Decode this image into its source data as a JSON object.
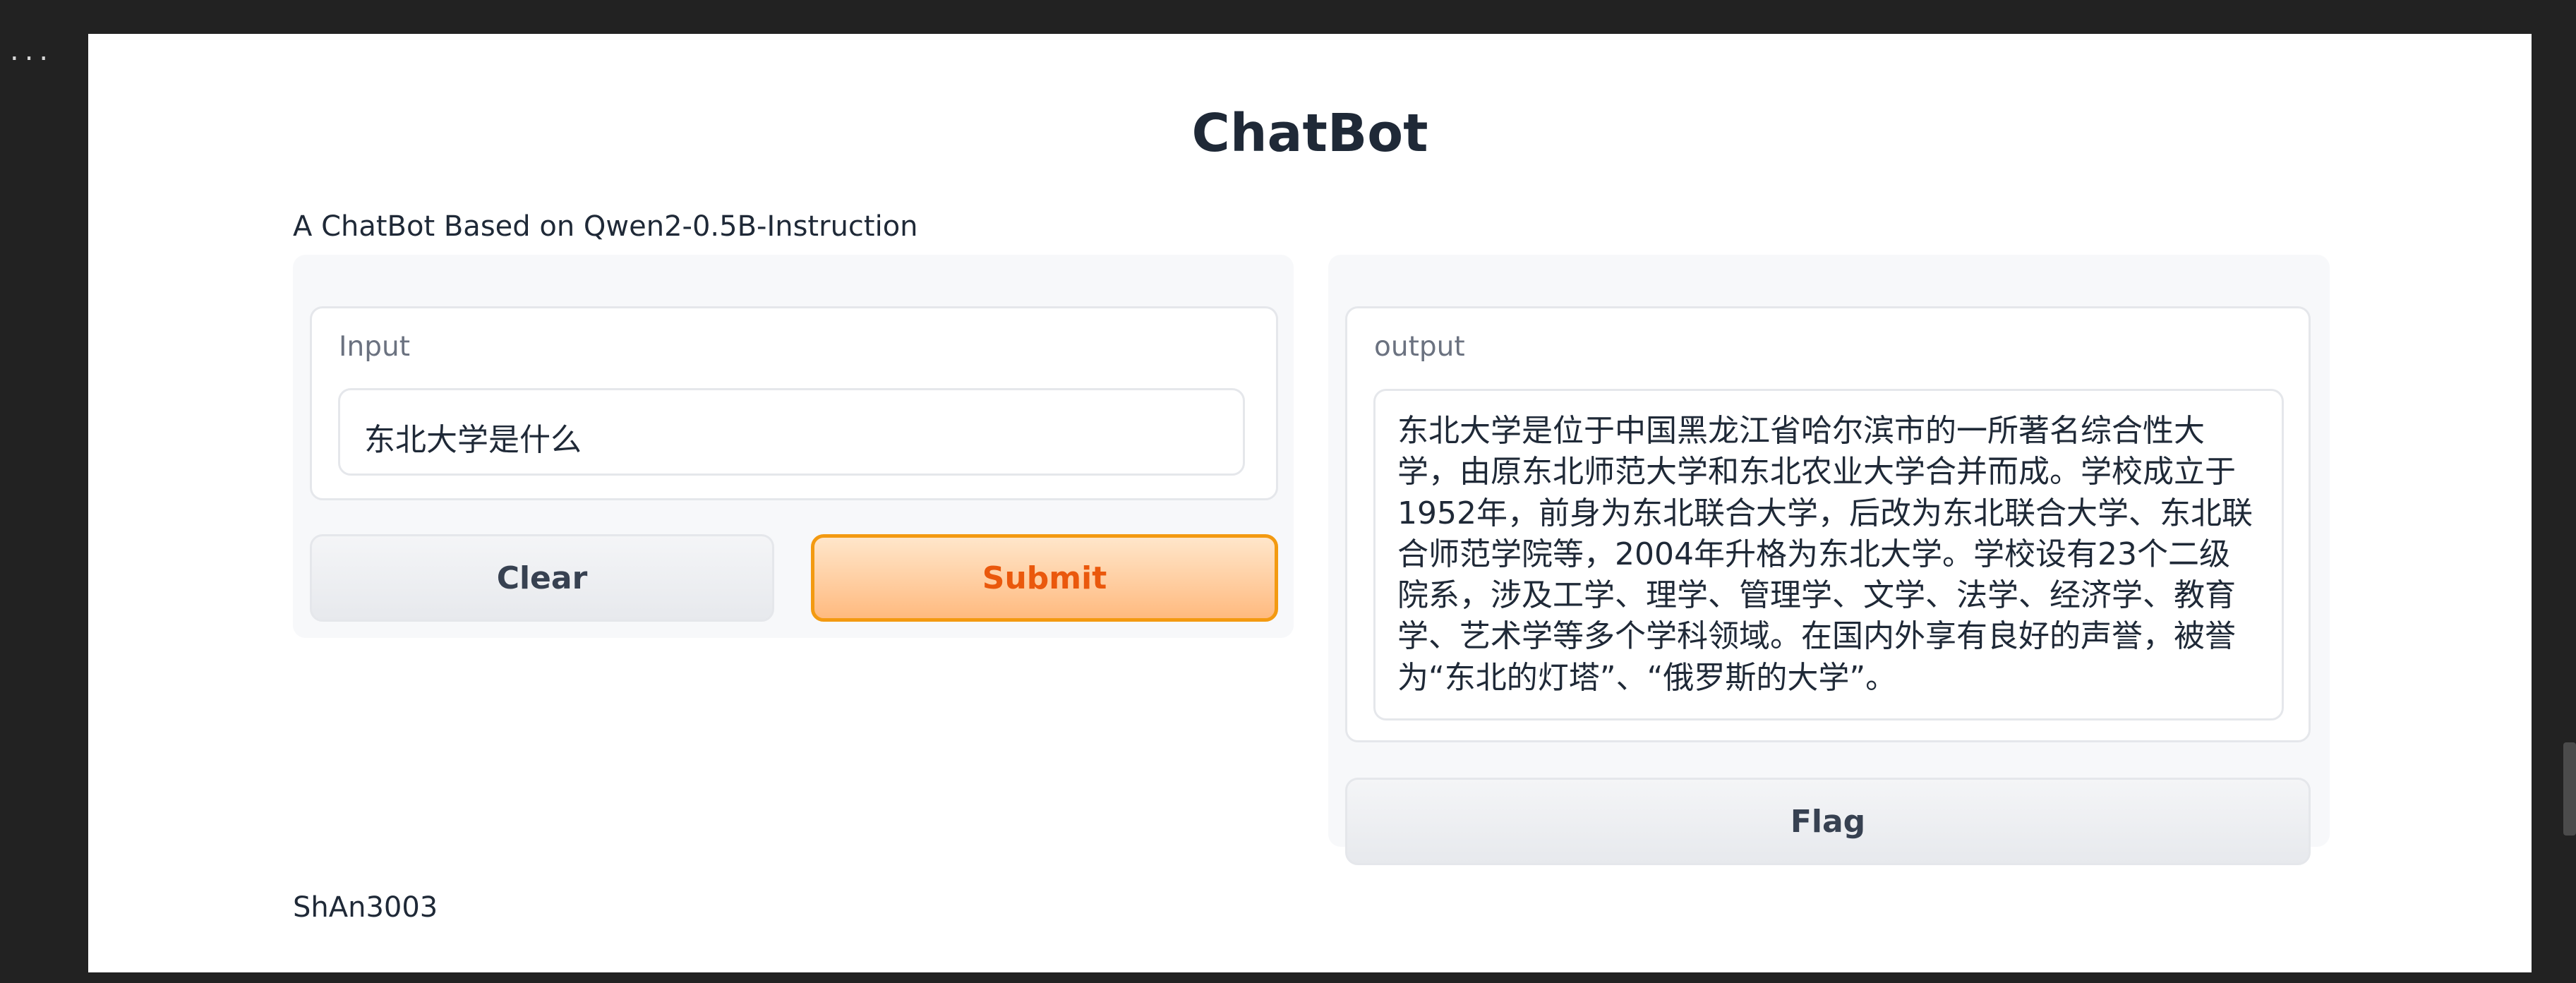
{
  "menu": {
    "dots": "..."
  },
  "header": {
    "title": "ChatBot",
    "description": "A ChatBot Based on Qwen2-0.5B-Instruction"
  },
  "input_panel": {
    "label": "Input",
    "value": "东北大学是什么",
    "clear_label": "Clear",
    "submit_label": "Submit"
  },
  "output_panel": {
    "label": "output",
    "value": "东北大学是位于中国黑龙江省哈尔滨市的一所著名综合性大学，由原东北师范大学和东北农业大学合并而成。学校成立于1952年，前身为东北联合大学，后改为东北联合大学、东北联合师范学院等，2004年升格为东北大学。学校设有23个二级院系，涉及工学、理学、管理学、文学、法学、经济学、教育学、艺术学等多个学科领域。在国内外享有良好的声誉，被誉为“东北的灯塔”、“俄罗斯的大学”。",
    "flag_label": "Flag"
  },
  "footer": {
    "text": "ShAn3003"
  },
  "colors": {
    "background": "#222222",
    "accent_orange": "#ea580c",
    "submit_border": "#f39a11"
  }
}
